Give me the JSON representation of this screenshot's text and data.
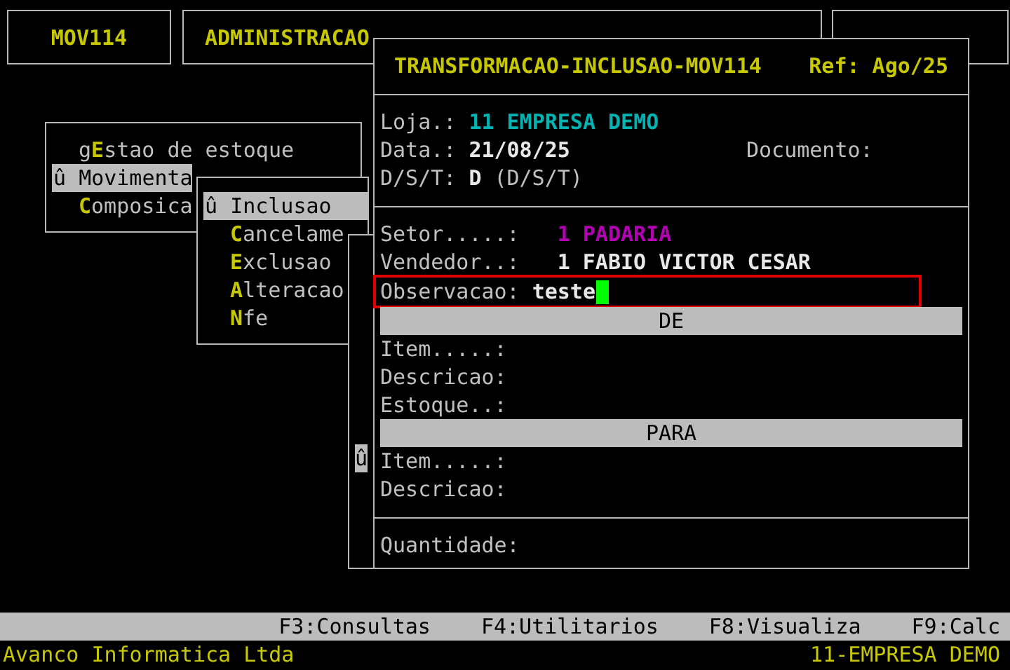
{
  "program_box": {
    "label": "MOV114"
  },
  "module_box": {
    "label": "ADMINISTRACAO"
  },
  "menu": {
    "selection_marker": "û",
    "items": [
      {
        "prefix": "g",
        "hotkey": "E",
        "rest": "stao de estoque",
        "selected": false
      },
      {
        "hotkey": "M",
        "rest": "ovimenta",
        "selected": true
      },
      {
        "hotkey": "C",
        "rest": "omposica",
        "selected": false
      }
    ]
  },
  "submenu": {
    "selection_marker": "û",
    "items": [
      {
        "hotkey": "I",
        "rest": "nclusao",
        "selected": true
      },
      {
        "hotkey": "C",
        "rest": "ancelame",
        "selected": false
      },
      {
        "hotkey": "E",
        "rest": "xclusao",
        "selected": false
      },
      {
        "hotkey": "A",
        "rest": "lteracao",
        "selected": false
      },
      {
        "hotkey": "N",
        "rest": "fe",
        "selected": false
      }
    ]
  },
  "background_window": {
    "marker": "û"
  },
  "form": {
    "title": "TRANSFORMACAO-INCLUSAO-MOV114",
    "ref": "Ref: Ago/25",
    "rows": [
      {
        "kind": "separator"
      },
      {
        "kind": "field",
        "label": "Loja.:",
        "value": "11 EMPRESA DEMO",
        "color": "#00b4b4"
      },
      {
        "kind": "field",
        "label": "Data.:",
        "value": "21/08/25",
        "color": "#e8e8e8",
        "extra_label": "Documento:"
      },
      {
        "kind": "field",
        "label": "D/S/T:",
        "value": "D",
        "color": "#e8e8e8",
        "hint": "(D/S/T)"
      },
      {
        "kind": "separator"
      },
      {
        "kind": "lookup",
        "label": "Setor.....:",
        "value": "1 PADARIA",
        "color": "#b400b4"
      },
      {
        "kind": "lookup",
        "label": "Vendedor..:",
        "value": "1 FABIO VICTOR CESAR",
        "color": "#e8e8e8"
      },
      {
        "kind": "input",
        "label": "Observacao:",
        "value": "teste",
        "focused": true,
        "annotated": true
      },
      {
        "kind": "heading",
        "label": "DE"
      },
      {
        "kind": "empty",
        "label": "Item.....:"
      },
      {
        "kind": "empty",
        "label": "Descricao:"
      },
      {
        "kind": "empty",
        "label": "Estoque..:"
      },
      {
        "kind": "heading",
        "label": "PARA"
      },
      {
        "kind": "empty",
        "label": "Item.....:"
      },
      {
        "kind": "empty",
        "label": "Descricao:"
      },
      {
        "kind": "separator"
      },
      {
        "kind": "empty",
        "label": "Quantidade:"
      }
    ]
  },
  "function_keys": [
    "F3:Consultas",
    "F4:Utilitarios",
    "F8:Visualiza",
    "F9:Calc"
  ],
  "status_bar": {
    "company": "Avanco Informatica Ltda",
    "store": "11-EMPRESA DEMO"
  }
}
